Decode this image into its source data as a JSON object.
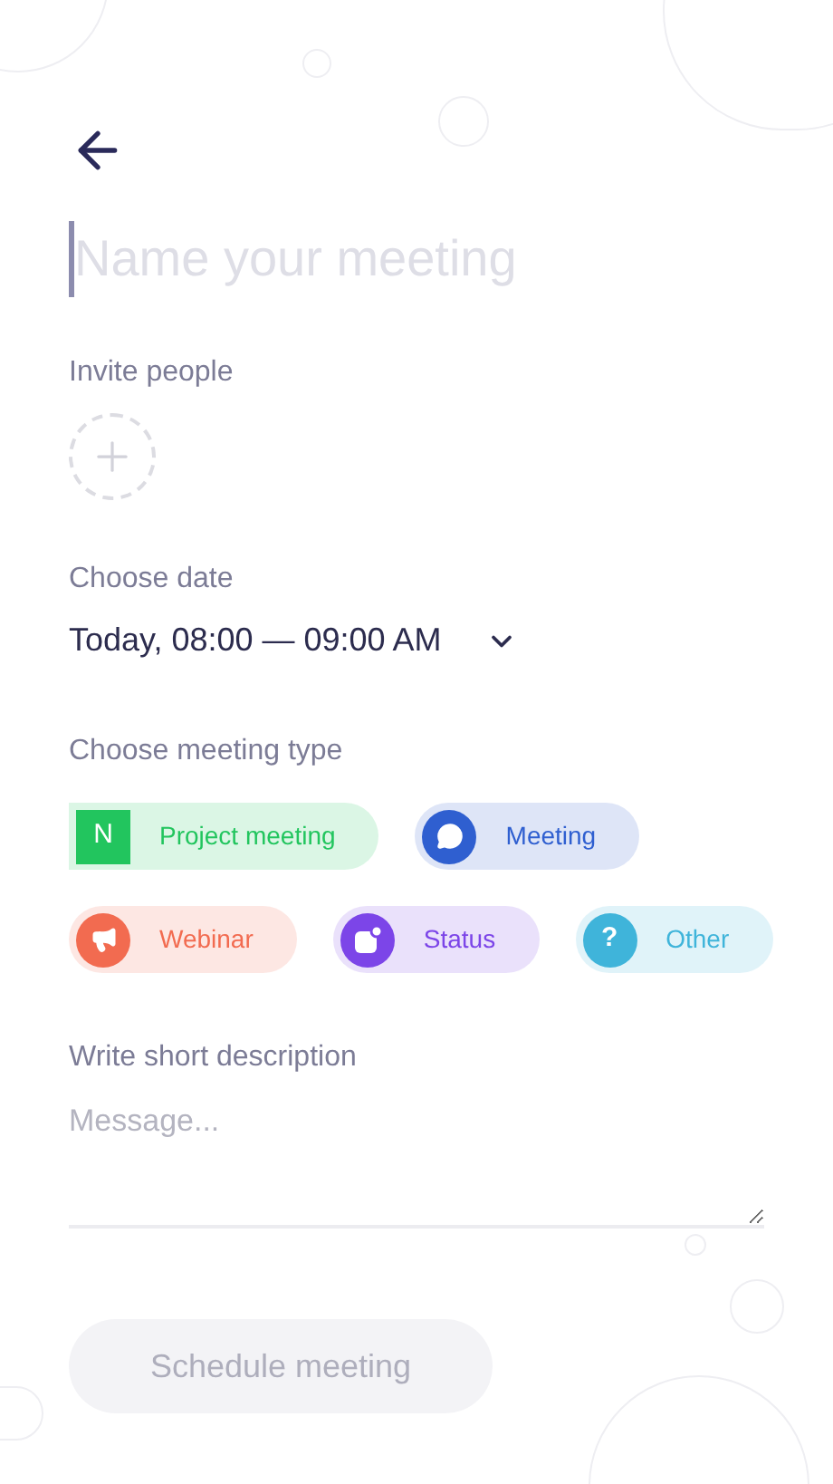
{
  "title_field": {
    "placeholder": "Name your meeting"
  },
  "invite": {
    "label": "Invite people"
  },
  "date": {
    "label": "Choose date",
    "value": "Today, 08:00 — 09:00 AM"
  },
  "meeting_type": {
    "label": "Choose meeting type",
    "types": [
      {
        "label": "Project meeting",
        "kind": "square",
        "badge": "N",
        "color": "#22c55e"
      },
      {
        "label": "Meeting",
        "kind": "chat",
        "color": "#2f5fd0"
      },
      {
        "label": "Webinar",
        "kind": "megaphone",
        "color": "#f26b50"
      },
      {
        "label": "Status",
        "kind": "status",
        "color": "#7c45e8"
      },
      {
        "label": "Other",
        "kind": "round",
        "badge": "?",
        "color": "#3fb4da"
      }
    ]
  },
  "description": {
    "label": "Write short description",
    "placeholder": "Message..."
  },
  "submit": {
    "label": "Schedule meeting",
    "disabled": true
  }
}
